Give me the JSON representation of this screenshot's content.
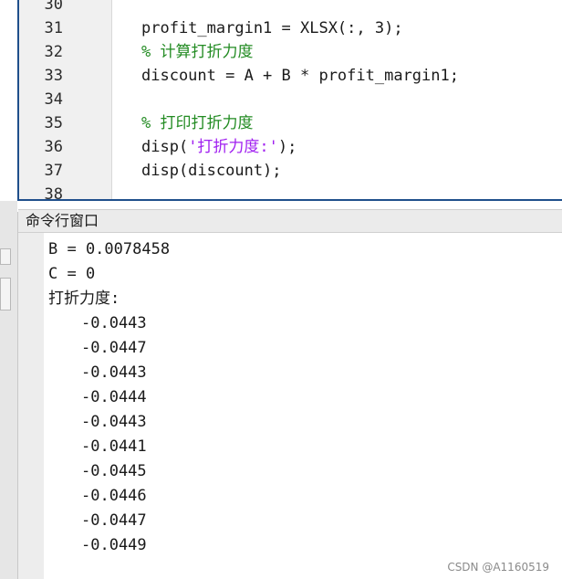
{
  "editor": {
    "lines": [
      {
        "num": "30",
        "segments": []
      },
      {
        "num": "31",
        "segments": [
          {
            "text": "profit_margin1 = XLSX(:, 3);",
            "kind": "plain"
          }
        ]
      },
      {
        "num": "32",
        "segments": [
          {
            "text": "% 计算打折力度",
            "kind": "comment"
          }
        ]
      },
      {
        "num": "33",
        "segments": [
          {
            "text": "discount = A + B * profit_margin1;",
            "kind": "plain"
          }
        ]
      },
      {
        "num": "34",
        "segments": []
      },
      {
        "num": "35",
        "segments": [
          {
            "text": "% 打印打折力度",
            "kind": "comment"
          }
        ]
      },
      {
        "num": "36",
        "segments": [
          {
            "text": "disp(",
            "kind": "plain"
          },
          {
            "text": "'打折力度:'",
            "kind": "string"
          },
          {
            "text": ");",
            "kind": "plain"
          }
        ]
      },
      {
        "num": "37",
        "segments": [
          {
            "text": "disp(discount);",
            "kind": "plain"
          }
        ]
      },
      {
        "num": "38",
        "segments": []
      }
    ]
  },
  "command_window": {
    "title": "命令行窗口",
    "output": [
      {
        "text": "B = 0.0078458",
        "indent": false
      },
      {
        "text": "C = 0",
        "indent": false
      },
      {
        "text": "打折力度:",
        "indent": false
      },
      {
        "text": "-0.0443",
        "indent": true
      },
      {
        "text": "-0.0447",
        "indent": true
      },
      {
        "text": "-0.0443",
        "indent": true
      },
      {
        "text": "-0.0444",
        "indent": true
      },
      {
        "text": "-0.0443",
        "indent": true
      },
      {
        "text": "-0.0441",
        "indent": true
      },
      {
        "text": "-0.0445",
        "indent": true
      },
      {
        "text": "-0.0446",
        "indent": true
      },
      {
        "text": "-0.0447",
        "indent": true
      },
      {
        "text": "-0.0449",
        "indent": true
      }
    ]
  },
  "watermark": "CSDN @A1160519",
  "colors": {
    "comment": "#228b22",
    "string": "#a020f0",
    "editor_border": "#1f4f8b"
  }
}
